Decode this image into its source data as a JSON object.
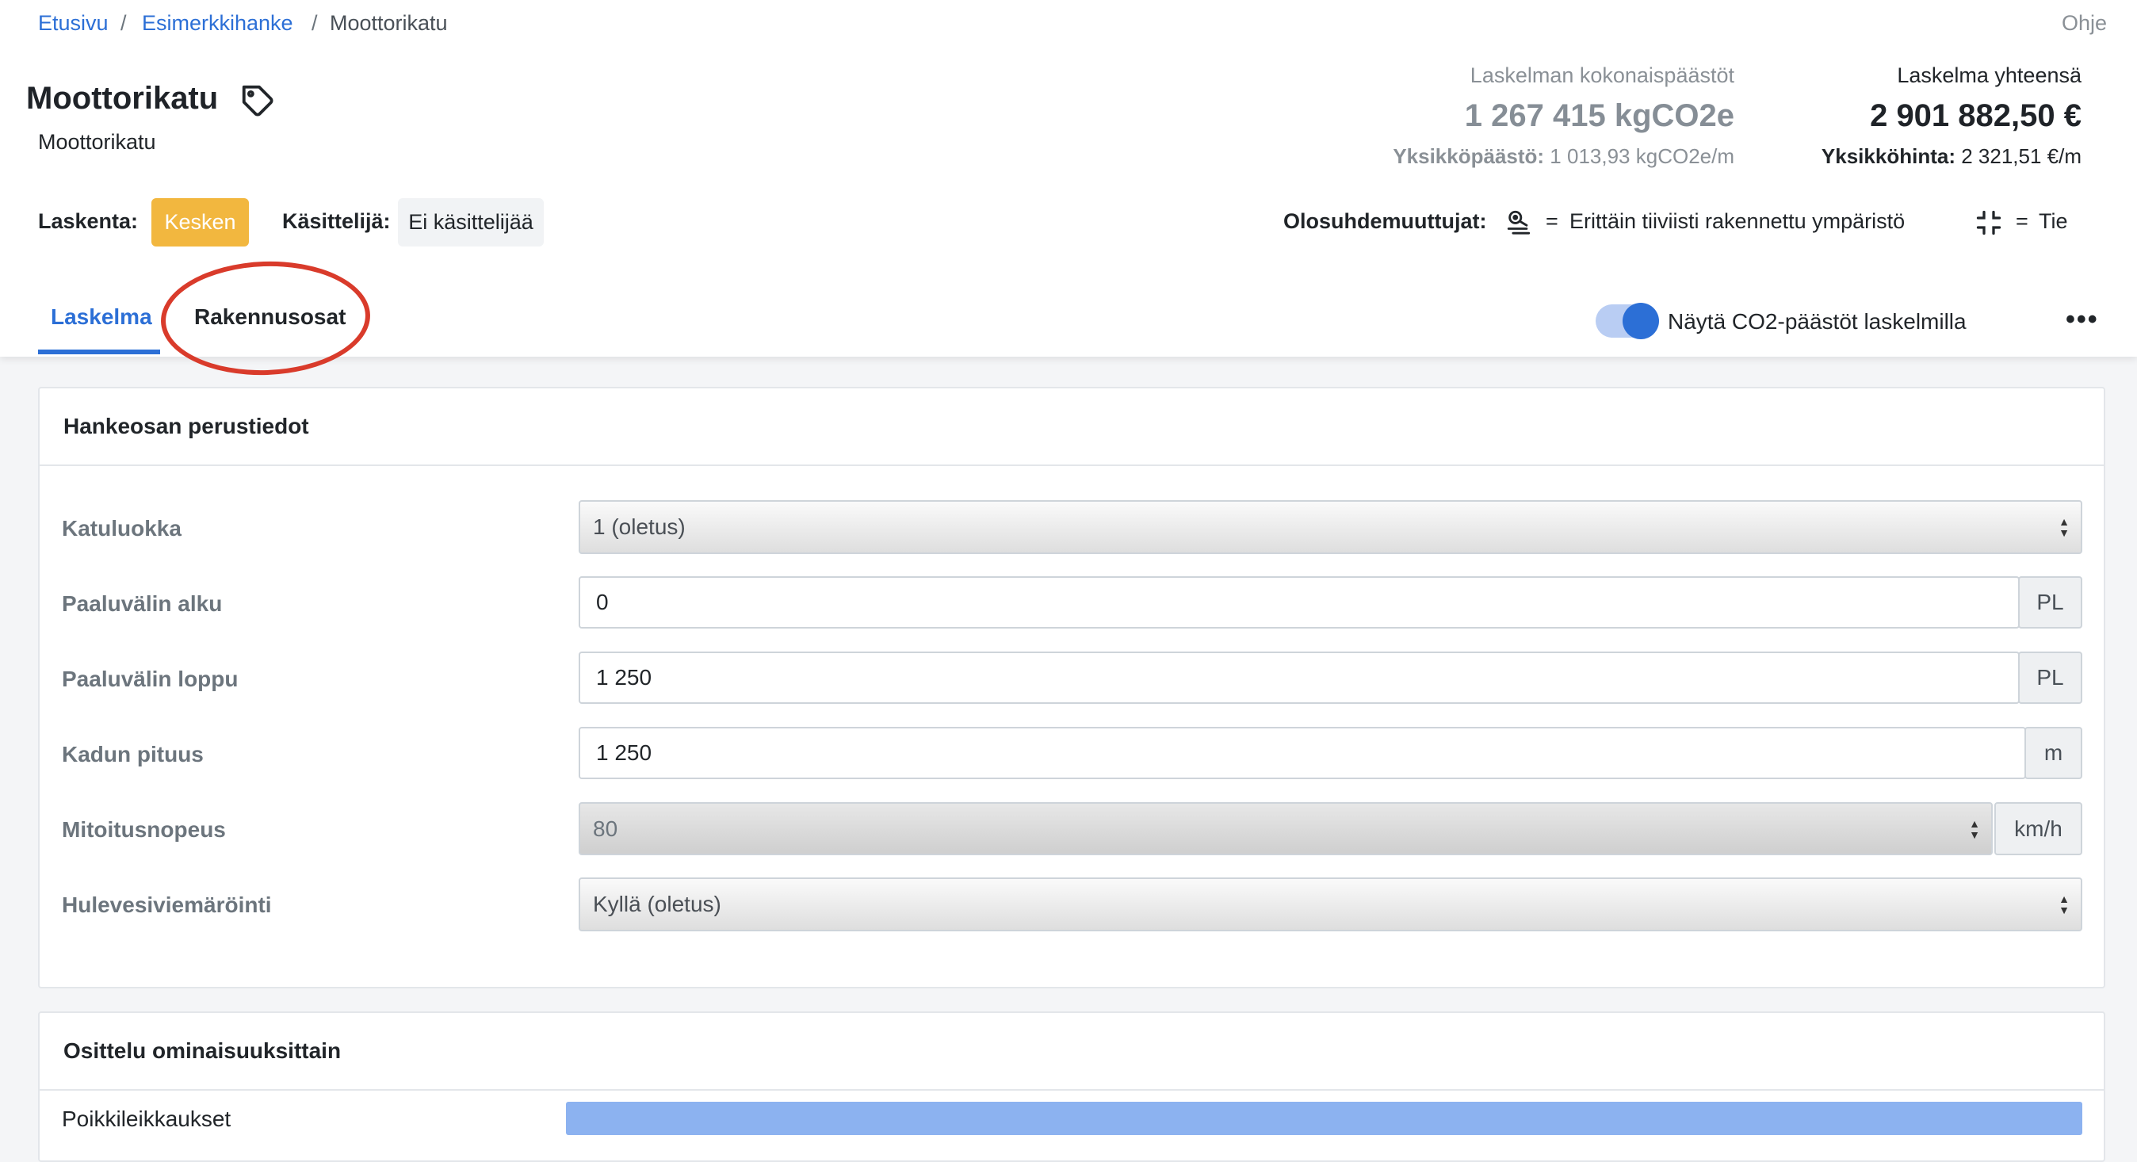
{
  "breadcrumb": {
    "items": [
      "Etusivu",
      "Esimerkkihanke",
      "Moottorikatu"
    ],
    "separator": "/"
  },
  "help_label": "Ohje",
  "page": {
    "title": "Moottorikatu",
    "subtitle": "Moottorikatu",
    "title_icon": "tag-icon"
  },
  "stats": {
    "emissions": {
      "label": "Laskelman kokonaispäästöt",
      "value": "1 267 415 kgCO2e",
      "unit_label": "Yksikköpäästö:",
      "unit_value": "1 013,93 kgCO2e/m"
    },
    "total": {
      "label": "Laskelma yhteensä",
      "value": "2 901 882,50 €",
      "unit_label": "Yksikköhinta:",
      "unit_value": "2 321,51 €/m"
    }
  },
  "status": {
    "calc_label": "Laskenta:",
    "calc_value": "Kesken",
    "handler_label": "Käsittelijä:",
    "handler_value": "Ei käsittelijää"
  },
  "conditions": {
    "label": "Olosuhdemuuttujat:",
    "items": [
      {
        "icon": "dense-environment-icon",
        "eq": "=",
        "text": "Erittäin tiiviisti rakennettu ympäristö"
      },
      {
        "icon": "road-icon",
        "eq": "=",
        "text": "Tie"
      }
    ]
  },
  "tabs": {
    "items": [
      {
        "label": "Laskelma",
        "active": true
      },
      {
        "label": "Rakennusosat",
        "active": false
      }
    ]
  },
  "toggle": {
    "label": "Näytä CO2-päästöt laskelmilla",
    "on": true
  },
  "more_label": "•••",
  "basic_info": {
    "title": "Hankeosan perustiedot",
    "fields": [
      {
        "label": "Katuluokka",
        "value": "1 (oletus)",
        "kind": "select"
      },
      {
        "label": "Paaluvälin alku",
        "value": "0",
        "unit": "PL",
        "kind": "input"
      },
      {
        "label": "Paaluvälin loppu",
        "value": "1 250",
        "unit": "PL",
        "kind": "input"
      },
      {
        "label": "Kadun pituus",
        "value": "1 250",
        "unit": "m",
        "kind": "input"
      },
      {
        "label": "Mitoitusnopeus",
        "value": "80",
        "unit": "km/h",
        "kind": "select-disabled"
      },
      {
        "label": "Hulevesiviemäröinti",
        "value": "Kyllä (oletus)",
        "kind": "select"
      }
    ]
  },
  "breakdown": {
    "title": "Osittelu ominaisuuksittain",
    "rows": [
      {
        "label": "Poikkileikkaukset",
        "share": 1.0
      }
    ]
  },
  "colors": {
    "accent": "#2c6fd6",
    "status_badge": "#f2b73f",
    "annotation": "#d93b2b",
    "bar": "#8cb2f0"
  }
}
